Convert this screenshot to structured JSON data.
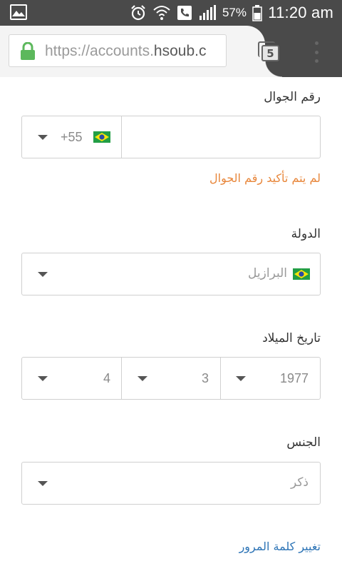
{
  "status_bar": {
    "battery_percent": "57%",
    "time": "11:20 am",
    "icons": [
      "gallery-icon",
      "alarm-icon",
      "wifi-icon",
      "phone-icon",
      "signal-icon",
      "battery-icon"
    ]
  },
  "browser": {
    "url_prefix": "https://accounts.",
    "url_host": "hsoub.c",
    "tab_count": "5",
    "colors": {
      "secure_lock": "#5cb85c",
      "accent_link": "#2d74b6",
      "error": "#e8863a"
    }
  },
  "form": {
    "phone": {
      "label": "رقم الجوال",
      "country_code": "+55",
      "value": "",
      "error": "لم يتم تأكيد رقم الجوال"
    },
    "country": {
      "label": "الدولة",
      "selected": "البرازيل"
    },
    "birthdate": {
      "label": "تاريخ الميلاد",
      "year": "1977",
      "month": "3",
      "day": "4"
    },
    "gender": {
      "label": "الجنس",
      "selected": "ذكر"
    },
    "change_password_link": "تغيير كلمة المرور"
  }
}
